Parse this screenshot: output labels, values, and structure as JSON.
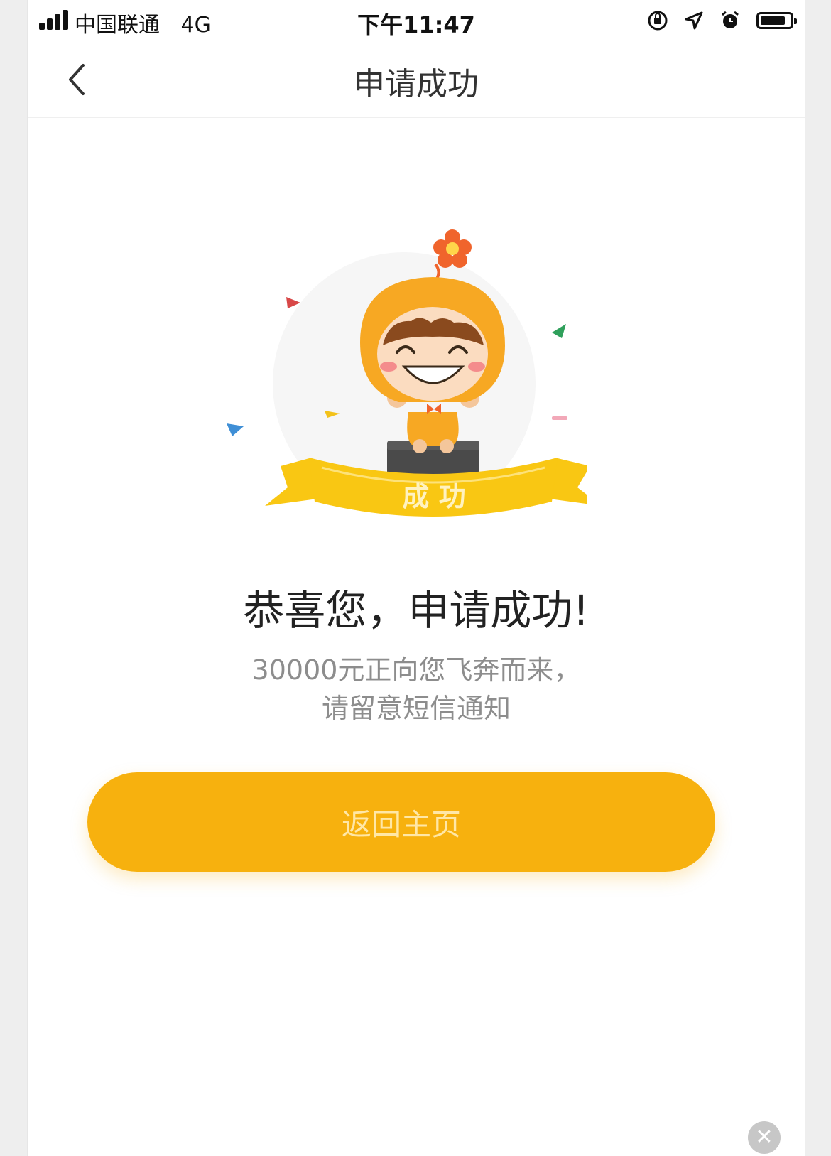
{
  "status_bar": {
    "carrier": "中国联通",
    "network": "4G",
    "time": "下午11:47"
  },
  "nav": {
    "back_icon": "chevron-left-icon",
    "title": "申请成功"
  },
  "illustration": {
    "banner_text": "成 功",
    "colors": {
      "orange": "#f7a823",
      "yellow": "#f9c713",
      "flower": "#f0642c"
    }
  },
  "content": {
    "headline": "恭喜您，申请成功!",
    "line1": "30000元正向您飞奔而来，",
    "line2": "请留意短信通知"
  },
  "button": {
    "label": "返回主页",
    "color": "#f7b10e"
  }
}
